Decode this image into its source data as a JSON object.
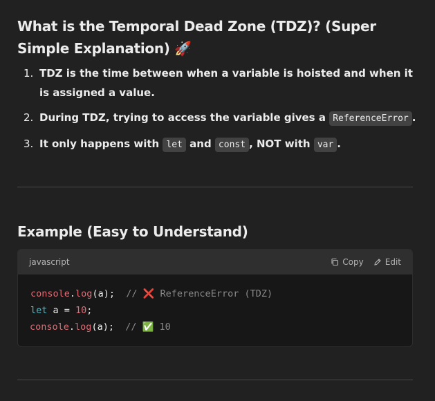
{
  "heading": {
    "title": "What is the Temporal Dead Zone (TDZ)? (Super Simple Explanation)",
    "emoji": "🚀"
  },
  "points": [
    {
      "num": "1.",
      "text": "TDZ is the time between when a variable is hoisted and when it is assigned a value."
    },
    {
      "num": "2.",
      "pre": "During TDZ, trying to access the variable gives a ",
      "code": "ReferenceError",
      "post": "."
    },
    {
      "num": "3.",
      "pre": "It only happens with ",
      "code1": "let",
      "mid1": " and ",
      "code2": "const",
      "mid2": ", NOT with ",
      "code3": "var",
      "post": "."
    }
  ],
  "example": {
    "heading": "Example (Easy to Understand)",
    "language": "javascript",
    "copy_label": "Copy",
    "edit_label": "Edit",
    "code": {
      "line1": {
        "obj": "console",
        "dot": ".",
        "fn": "log",
        "args": "(a);",
        "space": "  ",
        "comment": "// ❌ ReferenceError (TDZ)"
      },
      "line2": {
        "kw": "let",
        "mid": " a = ",
        "num": "10",
        "end": ";"
      },
      "line3": {
        "obj": "console",
        "dot": ".",
        "fn": "log",
        "args": "(a);",
        "space": "  ",
        "comment": "// ✅ 10"
      }
    }
  }
}
